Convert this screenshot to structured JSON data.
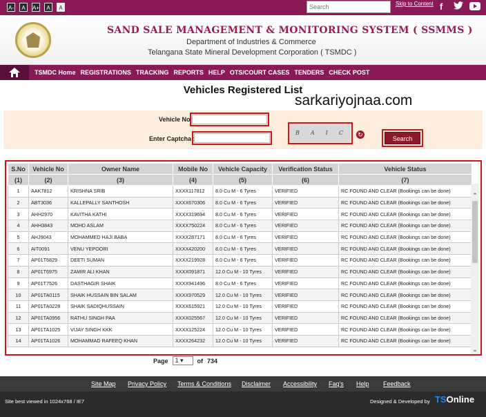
{
  "topbar": {
    "font_buttons": [
      "A-",
      "A",
      "A+",
      "A",
      "A"
    ],
    "search_placeholder": "Search",
    "skip_link": "Skip to Content",
    "social": {
      "facebook": "f",
      "twitter": "t",
      "youtube": "▶"
    }
  },
  "header": {
    "title": "SAND SALE MANAGEMENT & MONITORING SYSTEM ( SSMMS )",
    "dept": "Department of Industries & Commerce",
    "corp": "Telangana State Mineral Development Corporation ( TSMDC )"
  },
  "nav": [
    "TSMDC Home",
    "REGISTRATIONS",
    "TRACKING",
    "REPORTS",
    "HELP",
    "OTS/COURT CASES",
    "TENDERS",
    "CHECK POST"
  ],
  "page_title": "Vehicles Registered List",
  "watermark": "sarkariyojnaa.com",
  "form": {
    "vehicle_label": "Vehicle No",
    "captcha_label": "Enter Captcha :",
    "captcha_text": "BAIC",
    "search_button": "Search"
  },
  "table": {
    "headers": [
      "S.No",
      "Vehicle No",
      "Owner Name",
      "Mobile No",
      "Vehicle Capacity",
      "Verification Status",
      "Vehicle Status"
    ],
    "numbers": [
      "(1)",
      "(2)",
      "(3)",
      "(4)",
      "(5)",
      "(6)",
      "(7)"
    ],
    "rows": [
      [
        "1",
        "AAK7812",
        "KRISHNA SRIB",
        "XXXX117812",
        "8.0 Cu M - 6 Tyres",
        "VERIFIED",
        "RC FOUND AND CLEAR (Bookings can be done)"
      ],
      [
        "2",
        "ABT3036",
        "KALLEPALLY SANTHOSH",
        "XXXX670306",
        "8.0 Cu M - 6 Tyres",
        "VERIFIED",
        "RC FOUND AND CLEAR (Bookings can be done)"
      ],
      [
        "3",
        "AHH2970",
        "KAVITHA KATHI",
        "XXXX319694",
        "8.0 Cu M - 6 Tyres",
        "VERIFIED",
        "RC FOUND AND CLEAR (Bookings can be done)"
      ],
      [
        "4",
        "AHH3843",
        "MOHD ASLAM",
        "XXXX750224",
        "8.0 Cu M - 6 Tyres",
        "VERIFIED",
        "RC FOUND AND CLEAR (Bookings can be done)"
      ],
      [
        "5",
        "AHJ9043",
        "MOHAMMED HAJI BABA",
        "XXXX287171",
        "8.0 Cu M - 6 Tyres",
        "VERIFIED",
        "RC FOUND AND CLEAR (Bookings can be done)"
      ],
      [
        "6",
        "AIT0091",
        "VENU YEPOORI",
        "XXXX420200",
        "8.0 Cu M - 6 Tyres",
        "VERIFIED",
        "RC FOUND AND CLEAR (Bookings can be done)"
      ],
      [
        "7",
        "AP01T6829",
        "DEETI SUMAN",
        "XXXX219928",
        "8.0 Cu M - 6 Tyres",
        "VERIFIED",
        "RC FOUND AND CLEAR (Bookings can be done)"
      ],
      [
        "8",
        "AP01T6975",
        "ZAMIR ALI KHAN",
        "XXXX091871",
        "12.0 Cu M - 10 Tyres",
        "VERIFIED",
        "RC FOUND AND CLEAR (Bookings can be done)"
      ],
      [
        "9",
        "AP01T7526",
        "DASTHAGIR SHAIK",
        "XXXX941496",
        "8.0 Cu M - 6 Tyres",
        "VERIFIED",
        "RC FOUND AND CLEAR (Bookings can be done)"
      ],
      [
        "10",
        "AP01TA0115",
        "SHAIK HUSSAIN BIN SALAM",
        "XXXX970529",
        "12.0 Cu M - 10 Tyres",
        "VERIFIED",
        "RC FOUND AND CLEAR (Bookings can be done)"
      ],
      [
        "11",
        "AP01TA0228",
        "SHAIK SADIQHUSSAIN",
        "XXXX615921",
        "12.0 Cu M - 10 Tyres",
        "VERIFIED",
        "RC FOUND AND CLEAR (Bookings can be done)"
      ],
      [
        "12",
        "AP01TA0956",
        "RATHU SINGH PAA",
        "XXXX025567",
        "12.0 Cu M - 10 Tyres",
        "VERIFIED",
        "RC FOUND AND CLEAR (Bookings can be done)"
      ],
      [
        "13",
        "AP01TA1025",
        "VIJAY SINGH KKK",
        "XXXX125224",
        "12.0 Cu M - 10 Tyres",
        "VERIFIED",
        "RC FOUND AND CLEAR (Bookings can be done)"
      ],
      [
        "14",
        "AP01TA1026",
        "MOHAMMAD RAFEEQ KHAN",
        "XXXX264232",
        "12.0 Cu M - 10 Tyres",
        "VERIFIED",
        "RC FOUND AND CLEAR (Bookings can be done)"
      ]
    ]
  },
  "pager": {
    "label": "Page",
    "current": "1",
    "of": "of",
    "total": "734"
  },
  "footer": {
    "links": [
      "Site Map",
      "Privacy Policy",
      "Terms & Conditions",
      "Disclaimer",
      "Accessibility",
      "Faq's",
      "Help",
      "Feedback"
    ],
    "best_viewed": "Site best viewed in 1024x768 / IE7",
    "designed": "Designed & Developed by",
    "brand_ts": "TS",
    "brand_online": "Online"
  },
  "colors": {
    "brand": "#8a1a55",
    "highlight": "#d0141c",
    "form_bg": "#fdeedd"
  }
}
